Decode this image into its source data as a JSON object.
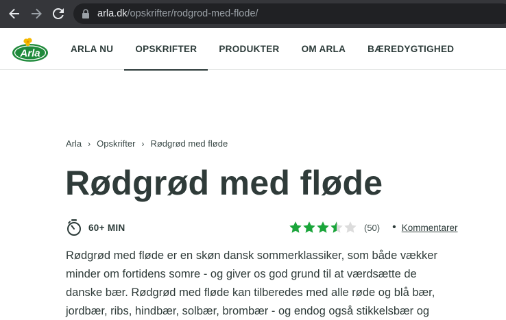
{
  "browser": {
    "url_host": "arla.dk",
    "url_path": "/opskrifter/rodgrod-med-flode/",
    "icons": [
      "back-icon",
      "forward-icon",
      "reload-icon",
      "lock-icon"
    ]
  },
  "header": {
    "logo_text": "Arla",
    "menu": [
      {
        "label": "ARLA NU",
        "active": false
      },
      {
        "label": "OPSKRIFTER",
        "active": true
      },
      {
        "label": "PRODUKTER",
        "active": false
      },
      {
        "label": "OM ARLA",
        "active": false
      },
      {
        "label": "BÆREDYGTIGHED",
        "active": false
      }
    ]
  },
  "breadcrumb": {
    "items": [
      "Arla",
      "Opskrifter",
      "Rødgrød med fløde"
    ],
    "separator": "›"
  },
  "recipe": {
    "title": "Rødgrød med fløde",
    "time": "60+ MIN",
    "rating": {
      "value": 3.5,
      "max": 5,
      "count": "(50)",
      "star_color": "#1aa53a",
      "empty_star_color": "#dcdcdc"
    },
    "comments_label": "Kommentarer",
    "intro": "Rødgrød med fløde er en skøn dansk sommerklassiker, som både vækker minder om fortidens somre - og giver os god grund til at værdsætte de danske bær. Rødgrød med fløde kan tilberedes med alle røde og blå bær, jordbær, ribs, hindbær, solbær, brombær - og endog også stikkelsbær og"
  },
  "colors": {
    "brand_green": "#1f8a3b",
    "text": "#2b3a38",
    "chrome": "#35363a"
  }
}
